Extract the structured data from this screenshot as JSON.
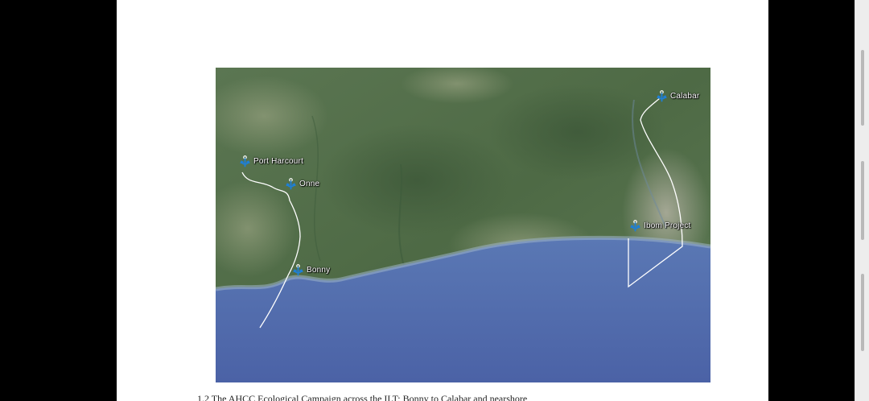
{
  "document": {
    "caption": "1.2 The AHCC Ecological Campaign across the ILT; Bonny to Calabar and nearshore"
  },
  "map": {
    "markers": [
      {
        "label": "Port Harcourt",
        "icon": "anchor-icon"
      },
      {
        "label": "Onne",
        "icon": "anchor-icon"
      },
      {
        "label": "Bonny",
        "icon": "anchor-icon"
      },
      {
        "label": "Calabar",
        "icon": "anchor-icon"
      },
      {
        "label": "Ibom Project",
        "icon": "anchor-icon"
      }
    ],
    "colors": {
      "land": "#4f6b48",
      "sea": "#5470b0",
      "route": "#ffffff",
      "anchor": "#1e7fd6"
    }
  }
}
